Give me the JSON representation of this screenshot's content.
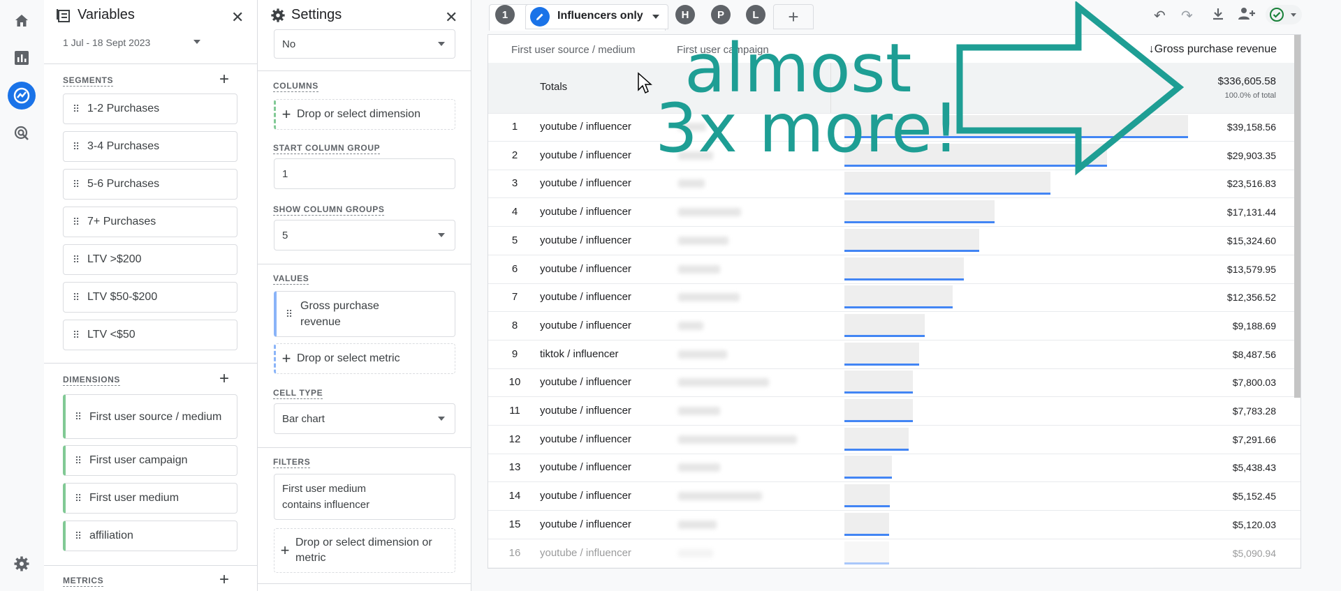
{
  "variables": {
    "title": "Variables",
    "date_range": "1 Jul - 18 Sept 2023",
    "segments_label": "SEGMENTS",
    "segments": [
      "1-2 Purchases",
      "3-4 Purchases",
      "5-6 Purchases",
      "7+ Purchases",
      "LTV >$200",
      "LTV $50-$200",
      "LTV <$50"
    ],
    "dimensions_label": "DIMENSIONS",
    "dimensions": [
      "First user source / medium",
      "First user campaign",
      "First user medium",
      "affiliation"
    ],
    "metrics_label": "METRICS"
  },
  "settings": {
    "title": "Settings",
    "top_value": "No",
    "columns_label": "COLUMNS",
    "drop_dimension": "Drop or select dimension",
    "start_column_group_label": "START COLUMN GROUP",
    "start_column_group_value": "1",
    "show_column_groups_label": "SHOW COLUMN GROUPS",
    "show_column_groups_value": "5",
    "values_label": "VALUES",
    "value_item": "Gross purchase revenue",
    "drop_metric": "Drop or select metric",
    "cell_type_label": "CELL TYPE",
    "cell_type_value": "Bar chart",
    "filters_label": "FILTERS",
    "filter_item": "First user medium contains influencer",
    "drop_dim_or_metric": "Drop or select dimension or metric"
  },
  "tabs": {
    "first": "1",
    "segment": "Influencers only",
    "comparisons": [
      "H",
      "P",
      "L"
    ]
  },
  "table": {
    "col_source": "First user source / medium",
    "col_campaign": "First user campaign",
    "col_revenue": "Gross purchase revenue",
    "totals_label": "Totals",
    "totals_value": "$336,605.58",
    "totals_pct": "100.0% of total",
    "rows": [
      {
        "idx": "1",
        "src": "youtube / influencer",
        "rev": "$39,158.56",
        "v": 39158.56
      },
      {
        "idx": "2",
        "src": "youtube / influencer",
        "rev": "$29,903.35",
        "v": 29903.35
      },
      {
        "idx": "3",
        "src": "youtube / influencer",
        "rev": "$23,516.83",
        "v": 23516.83
      },
      {
        "idx": "4",
        "src": "youtube / influencer",
        "rev": "$17,131.44",
        "v": 17131.44
      },
      {
        "idx": "5",
        "src": "youtube / influencer",
        "rev": "$15,324.60",
        "v": 15324.6
      },
      {
        "idx": "6",
        "src": "youtube / influencer",
        "rev": "$13,579.95",
        "v": 13579.95
      },
      {
        "idx": "7",
        "src": "youtube / influencer",
        "rev": "$12,356.52",
        "v": 12356.52
      },
      {
        "idx": "8",
        "src": "youtube / influencer",
        "rev": "$9,188.69",
        "v": 9188.69
      },
      {
        "idx": "9",
        "src": "tiktok / influencer",
        "rev": "$8,487.56",
        "v": 8487.56
      },
      {
        "idx": "10",
        "src": "youtube / influencer",
        "rev": "$7,800.03",
        "v": 7800.03
      },
      {
        "idx": "11",
        "src": "youtube / influencer",
        "rev": "$7,783.28",
        "v": 7783.28
      },
      {
        "idx": "12",
        "src": "youtube / influencer",
        "rev": "$7,291.66",
        "v": 7291.66
      },
      {
        "idx": "13",
        "src": "youtube / influencer",
        "rev": "$5,438.43",
        "v": 5438.43
      },
      {
        "idx": "14",
        "src": "youtube / influencer",
        "rev": "$5,152.45",
        "v": 5152.45
      },
      {
        "idx": "15",
        "src": "youtube / influencer",
        "rev": "$5,120.03",
        "v": 5120.03
      },
      {
        "idx": "16",
        "src": "youtube / influencer",
        "rev": "$5,090.94",
        "v": 5090.94
      }
    ]
  },
  "annotation": {
    "line1": "almost",
    "line2": "3x more!",
    "color": "#1e9e94"
  }
}
